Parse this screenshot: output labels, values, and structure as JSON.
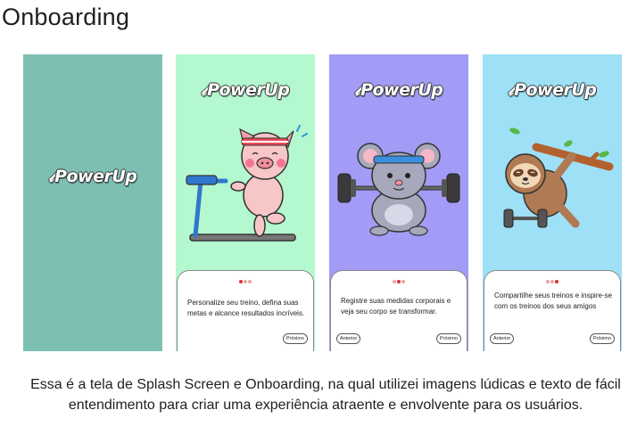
{
  "page": {
    "title": "Onboarding"
  },
  "brand": {
    "name": "PowerUp"
  },
  "colors": {
    "splash": "#7ebfb4",
    "onboarding_1": "#b3f8cf",
    "onboarding_2": "#a29cf6",
    "onboarding_3": "#9ee0f6",
    "dot_active": "#d93030"
  },
  "screens": [
    {
      "id": "splash",
      "logo": "PowerUp"
    },
    {
      "id": "onboarding-1",
      "illustration": "pig-on-treadmill-icon",
      "active_dot": 1,
      "text": "Personalize seu treino, defina suas metas e alcance resultados incríveis.",
      "buttons": {
        "next": "Próximo"
      }
    },
    {
      "id": "onboarding-2",
      "illustration": "mouse-lifting-barbell-icon",
      "active_dot": 2,
      "text": "Registre suas medidas corporais e veja seu corpo se transformar.",
      "buttons": {
        "prev": "Anterior",
        "next": "Próximo"
      }
    },
    {
      "id": "onboarding-3",
      "illustration": "sloth-with-dumbbell-icon",
      "active_dot": 3,
      "text": "Compartilhe seus treinos e inspire-se com os treinos dos seus amigos",
      "buttons": {
        "prev": "Anterior",
        "next": "Próximo"
      }
    }
  ],
  "caption": "Essa é a tela de Splash Screen e Onboarding, na qual utilizei imagens lúdicas e texto de fácil entendimento para criar uma experiência atraente e envolvente para os usuários."
}
